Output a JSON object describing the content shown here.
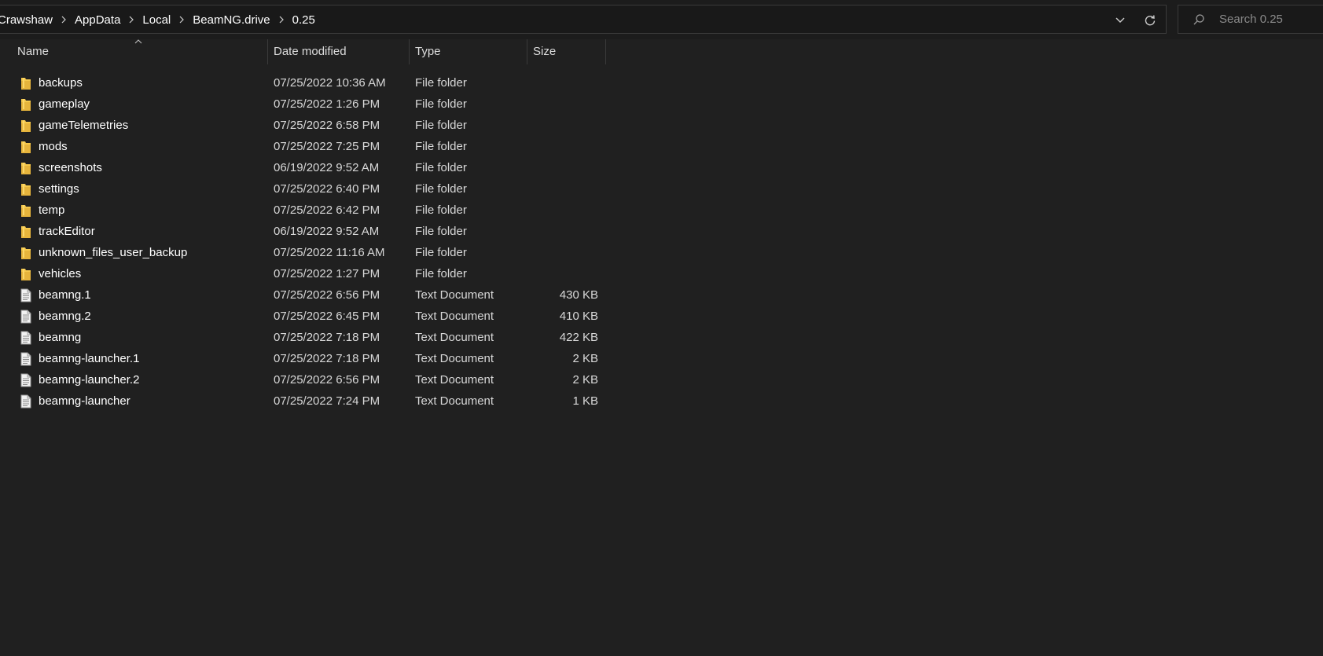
{
  "address_bar": {
    "breadcrumbs": [
      {
        "label": "Crawshaw"
      },
      {
        "label": "AppData"
      },
      {
        "label": "Local"
      },
      {
        "label": "BeamNG.drive"
      },
      {
        "label": "0.25"
      }
    ]
  },
  "search": {
    "placeholder": "Search 0.25",
    "value": ""
  },
  "columns": {
    "name": "Name",
    "date_modified": "Date modified",
    "type": "Type",
    "size": "Size"
  },
  "files": [
    {
      "name": "backups",
      "date": "07/25/2022 10:36 AM",
      "type": "File folder",
      "size": "",
      "icon": "folder-icon"
    },
    {
      "name": "gameplay",
      "date": "07/25/2022 1:26 PM",
      "type": "File folder",
      "size": "",
      "icon": "folder-icon"
    },
    {
      "name": "gameTelemetries",
      "date": "07/25/2022 6:58 PM",
      "type": "File folder",
      "size": "",
      "icon": "folder-icon"
    },
    {
      "name": "mods",
      "date": "07/25/2022 7:25 PM",
      "type": "File folder",
      "size": "",
      "icon": "folder-icon"
    },
    {
      "name": "screenshots",
      "date": "06/19/2022 9:52 AM",
      "type": "File folder",
      "size": "",
      "icon": "folder-icon"
    },
    {
      "name": "settings",
      "date": "07/25/2022 6:40 PM",
      "type": "File folder",
      "size": "",
      "icon": "folder-icon"
    },
    {
      "name": "temp",
      "date": "07/25/2022 6:42 PM",
      "type": "File folder",
      "size": "",
      "icon": "folder-icon"
    },
    {
      "name": "trackEditor",
      "date": "06/19/2022 9:52 AM",
      "type": "File folder",
      "size": "",
      "icon": "folder-icon"
    },
    {
      "name": "unknown_files_user_backup",
      "date": "07/25/2022 11:16 AM",
      "type": "File folder",
      "size": "",
      "icon": "folder-icon"
    },
    {
      "name": "vehicles",
      "date": "07/25/2022 1:27 PM",
      "type": "File folder",
      "size": "",
      "icon": "folder-icon"
    },
    {
      "name": "beamng.1",
      "date": "07/25/2022 6:56 PM",
      "type": "Text Document",
      "size": "430 KB",
      "icon": "text-document-icon"
    },
    {
      "name": "beamng.2",
      "date": "07/25/2022 6:45 PM",
      "type": "Text Document",
      "size": "410 KB",
      "icon": "text-document-icon"
    },
    {
      "name": "beamng",
      "date": "07/25/2022 7:18 PM",
      "type": "Text Document",
      "size": "422 KB",
      "icon": "text-document-icon"
    },
    {
      "name": "beamng-launcher.1",
      "date": "07/25/2022 7:18 PM",
      "type": "Text Document",
      "size": "2 KB",
      "icon": "text-document-icon"
    },
    {
      "name": "beamng-launcher.2",
      "date": "07/25/2022 6:56 PM",
      "type": "Text Document",
      "size": "2 KB",
      "icon": "text-document-icon"
    },
    {
      "name": "beamng-launcher",
      "date": "07/25/2022 7:24 PM",
      "type": "Text Document",
      "size": "1 KB",
      "icon": "text-document-icon"
    }
  ],
  "colors": {
    "background": "#202020",
    "folder": "#f5c84c",
    "text": "#ffffff"
  }
}
